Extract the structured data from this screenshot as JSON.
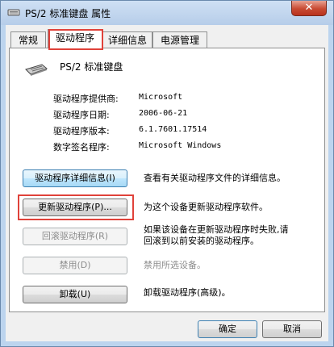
{
  "window": {
    "title": "PS/2 标准键盘 属性",
    "close_glyph": "✕"
  },
  "tabs": [
    {
      "label": "常规",
      "active": false
    },
    {
      "label": "驱动程序",
      "active": true
    },
    {
      "label": "详细信息",
      "active": false
    },
    {
      "label": "电源管理",
      "active": false
    }
  ],
  "device": {
    "name": "PS/2 标准键盘",
    "icon": "keyboard-icon"
  },
  "driver_info": [
    {
      "label": "驱动程序提供商:",
      "value": "Microsoft"
    },
    {
      "label": "驱动程序日期:",
      "value": "2006-06-21"
    },
    {
      "label": "驱动程序版本:",
      "value": "6.1.7601.17514"
    },
    {
      "label": "数字签名程序:",
      "value": "Microsoft Windows"
    }
  ],
  "actions": [
    {
      "button": "驱动程序详细信息(I)",
      "description": "查看有关驱动程序文件的详细信息。",
      "enabled": true
    },
    {
      "button": "更新驱动程序(P)...",
      "description": "为这个设备更新驱动程序软件。",
      "enabled": true
    },
    {
      "button": "回滚驱动程序(R)",
      "description_lines": [
        "如果该设备在更新驱动程序时失败,请",
        "回滚到以前安装的驱动程序。"
      ],
      "enabled": false
    },
    {
      "button": "禁用(D)",
      "description": "禁用所选设备。",
      "enabled": false
    },
    {
      "button": "卸载(U)",
      "description": "卸载驱动程序(高级)。",
      "enabled": true
    }
  ],
  "footer": {
    "ok": "确定",
    "cancel": "取消"
  },
  "colors": {
    "highlight": "#e0423a",
    "close": "#c84a32",
    "frame": "#bcd4ee"
  }
}
